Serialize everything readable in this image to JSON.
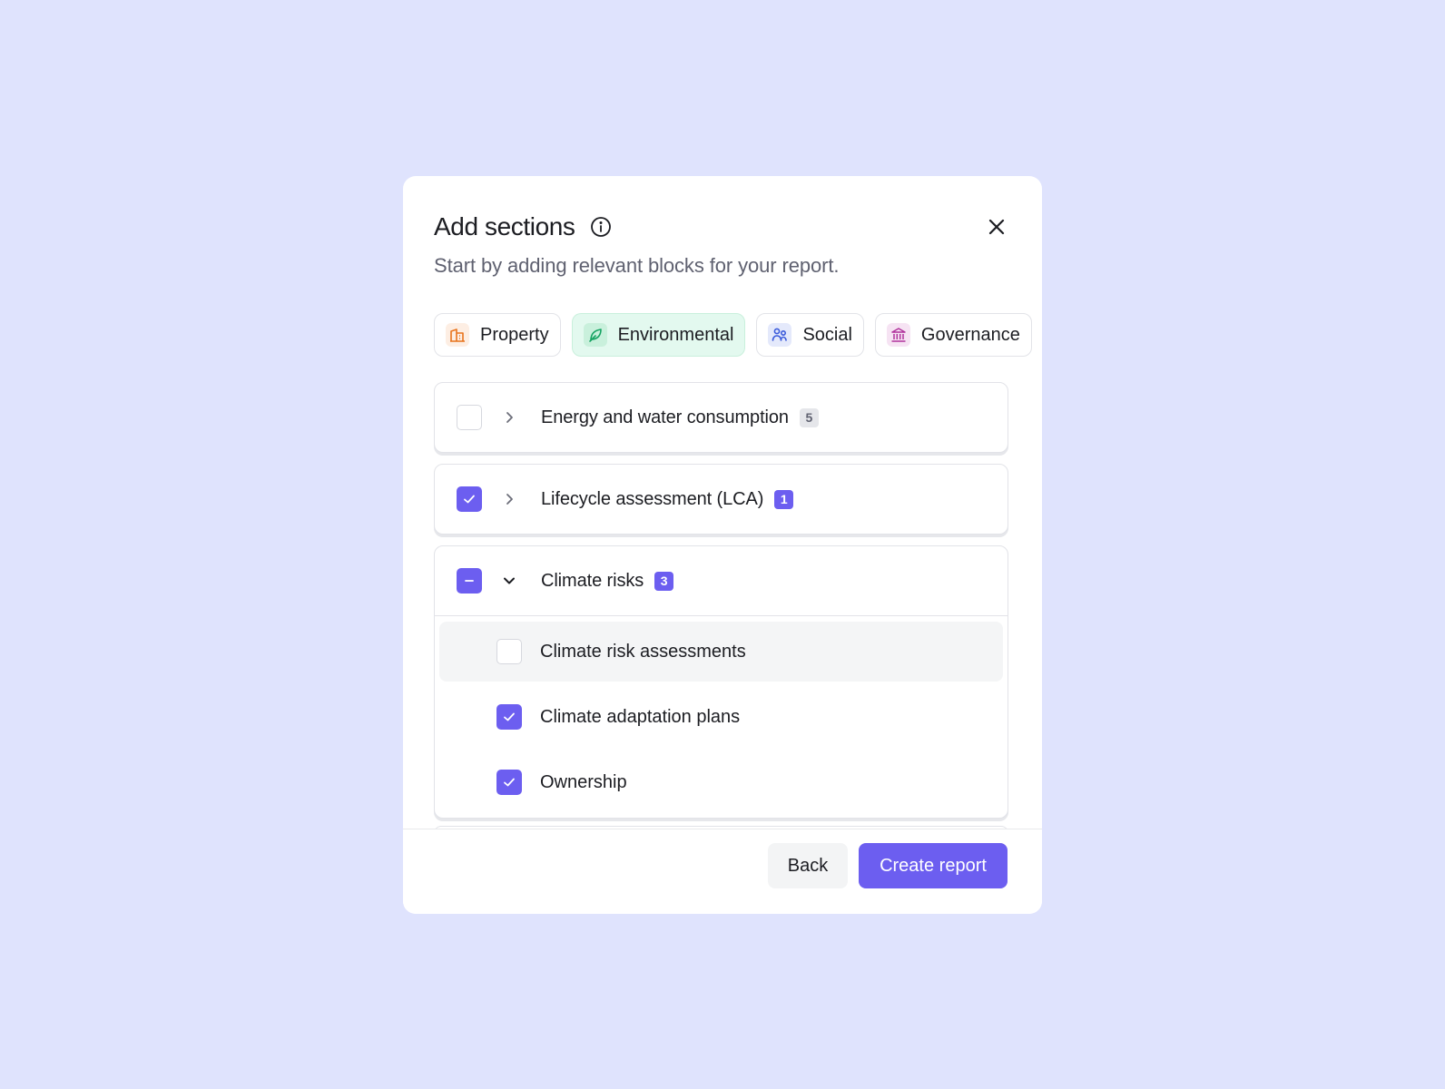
{
  "modal": {
    "title": "Add sections",
    "subtitle": "Start by adding relevant blocks for your report."
  },
  "tabs": [
    {
      "label": "Property",
      "icon": "building-icon",
      "active": false,
      "color": "#e8741c"
    },
    {
      "label": "Environmental",
      "icon": "leaf-icon",
      "active": true,
      "color": "#17a463"
    },
    {
      "label": "Social",
      "icon": "people-icon",
      "active": false,
      "color": "#3b5bdb"
    },
    {
      "label": "Governance",
      "icon": "bank-icon",
      "active": false,
      "color": "#b0339c"
    }
  ],
  "sections": [
    {
      "label": "Energy and water consumption",
      "count": "5",
      "state": "unchecked",
      "expanded": false
    },
    {
      "label": "Lifecycle assessment (LCA)",
      "count": "1",
      "state": "checked",
      "expanded": false
    },
    {
      "label": "Climate risks",
      "count": "3",
      "state": "partial",
      "expanded": true,
      "items": [
        {
          "label": "Climate risk assessments",
          "checked": false
        },
        {
          "label": "Climate adaptation plans",
          "checked": true
        },
        {
          "label": "Ownership",
          "checked": true
        }
      ]
    }
  ],
  "footer": {
    "back_label": "Back",
    "create_label": "Create report"
  },
  "colors": {
    "accent": "#6c5ef0",
    "background": "#dfe3fd"
  }
}
